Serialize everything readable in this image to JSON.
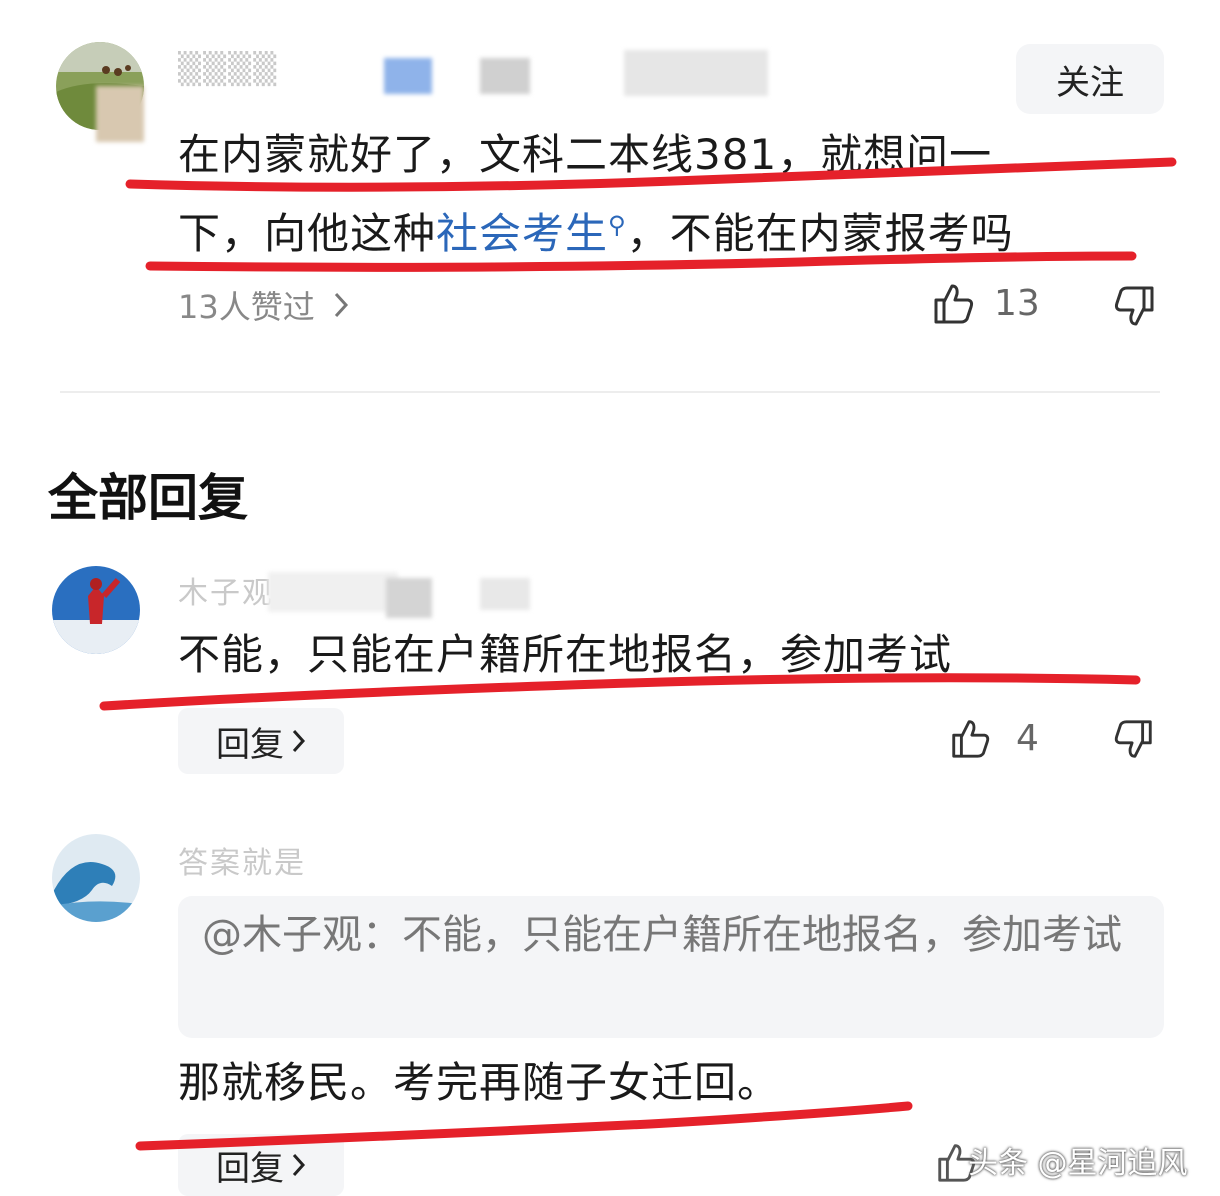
{
  "top_comment": {
    "follow_label": "关注",
    "text_line1": "在内蒙就好了，文科二本线381，就想问一",
    "text_line2_prefix": "下，向他这种",
    "link_text": "社会考生",
    "text_line2_suffix": "，不能在内蒙报考吗",
    "likes_summary": "13人赞过",
    "like_count": "13"
  },
  "section_title": "全部回复",
  "replies": [
    {
      "user_partial": "木子观",
      "text": "不能，只能在户籍所在地报名，参加考试",
      "reply_label": "回复",
      "like_count": "4"
    },
    {
      "user_partial": "答案就是",
      "quote": "@木子观：不能，只能在户籍所在地报名，参加考试",
      "text": "那就移民。考完再随子女迁回。",
      "reply_label": "回复"
    }
  ],
  "watermark": "头条 @星河追风",
  "colors": {
    "annotation_red": "#e5212a",
    "link_blue": "#2b67b9"
  }
}
